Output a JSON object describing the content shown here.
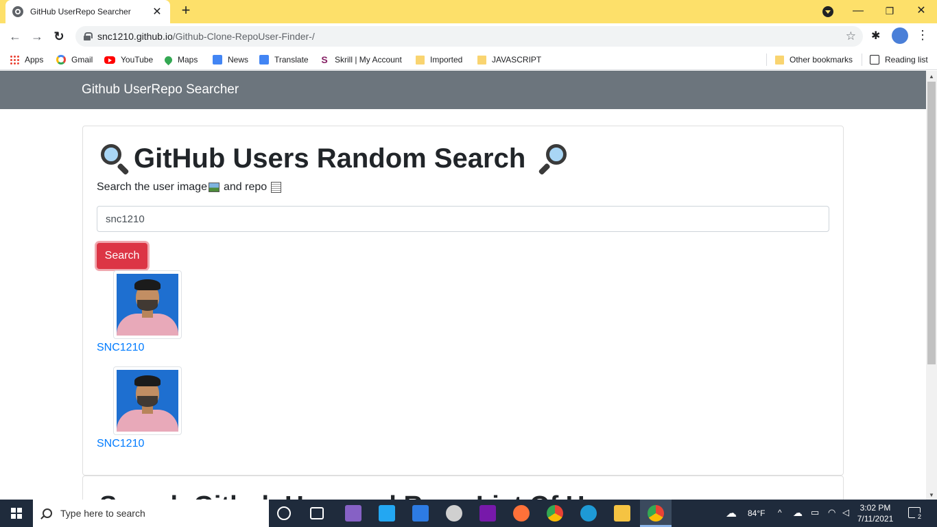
{
  "browser": {
    "tab_title": "GitHub UserRepo Searcher",
    "tab_close": "✕",
    "new_tab": "+",
    "url_host": "snc1210.github.io",
    "url_path": "/Github-Clone-RepoUser-Finder-/",
    "min": "—",
    "max": "❐",
    "close": "✕",
    "back": "←",
    "forward": "→",
    "reload": "↻",
    "star": "☆",
    "menu": "⋮"
  },
  "bookmarks": [
    {
      "label": "Apps",
      "icon": "apps-grid-icon"
    },
    {
      "label": "Gmail",
      "icon": "google-g-icon"
    },
    {
      "label": "YouTube",
      "icon": "youtube-icon"
    },
    {
      "label": "Maps",
      "icon": "maps-pin-icon"
    },
    {
      "label": "News",
      "icon": "news-icon"
    },
    {
      "label": "Translate",
      "icon": "translate-icon"
    },
    {
      "label": "Skrill | My Account",
      "icon": "skrill-icon"
    },
    {
      "label": "Imported",
      "icon": "folder-icon"
    },
    {
      "label": "JAVASCRIPT",
      "icon": "folder-icon"
    },
    {
      "label": "Other bookmarks",
      "icon": "folder-icon"
    },
    {
      "label": "Reading list",
      "icon": "reading-list-icon"
    }
  ],
  "page": {
    "brand": "Github UserRepo Searcher",
    "heading": "GitHub Users Random Search",
    "subtitle_part1": "Search the user image",
    "subtitle_part2": "and repo",
    "search_value": "snc1210",
    "search_button": "Search",
    "results": [
      {
        "name": "SNC1210"
      },
      {
        "name": "SNC1210"
      }
    ],
    "second_heading": "Search Github User and Repo List Of User"
  },
  "taskbar": {
    "search_placeholder": "Type here to search",
    "weather": "84°F",
    "time": "3:02 PM",
    "date": "7/11/2021",
    "notifications": "2"
  },
  "colors": {
    "tab_strip": "#fde06a",
    "navbar": "#6c757d",
    "danger": "#dc3545",
    "link": "#007bff"
  }
}
